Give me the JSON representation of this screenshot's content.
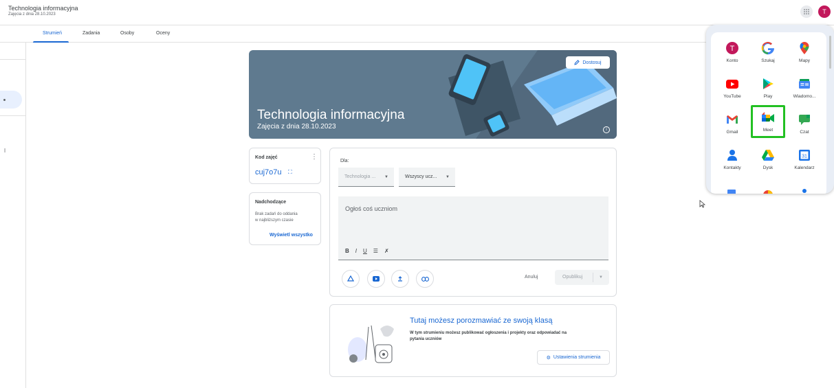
{
  "header": {
    "class_title": "Technologia informacyjna",
    "class_subtitle": "Zajęcia z dnia 28.10.2023",
    "avatar_letter": "T"
  },
  "tabs": [
    {
      "label": "Strumień",
      "active": true
    },
    {
      "label": "Zadania",
      "active": false
    },
    {
      "label": "Osoby",
      "active": false
    },
    {
      "label": "Oceny",
      "active": false
    }
  ],
  "banner": {
    "title": "Technologia informacyjna",
    "subtitle": "Zajęcia z dnia 28.10.2023",
    "customize_label": "Dostosuj"
  },
  "class_code": {
    "label": "Kod zajęć",
    "value": "cuj7o7u"
  },
  "upcoming": {
    "label": "Nadchodzące",
    "empty_line1": "Brak zadań do oddania",
    "empty_line2": "w najbliższym czasie",
    "view_all": "Wyświetl wszystko"
  },
  "composer": {
    "for_label": "Dla:",
    "class_select": "Technologia ...",
    "students_select": "Wszyscy ucz...",
    "placeholder": "Ogłoś coś uczniom",
    "format": {
      "bold": "B",
      "italic": "I",
      "underline": "U"
    },
    "cancel_label": "Anuluj",
    "publish_label": "Opublikuj"
  },
  "stream_empty": {
    "title": "Tutaj możesz porozmawiać ze swoją klasą",
    "desc_line1": "W tym strumieniu możesz publikować ogłoszenia i projekty oraz odpowiadać na",
    "desc_line2": "pytania uczniów",
    "settings_label": "Ustawienia strumienia"
  },
  "apps": [
    {
      "name": "Konto",
      "icon": "account-icon"
    },
    {
      "name": "Szukaj",
      "icon": "google-search-icon"
    },
    {
      "name": "Mapy",
      "icon": "maps-icon"
    },
    {
      "name": "YouTube",
      "icon": "youtube-icon"
    },
    {
      "name": "Play",
      "icon": "play-icon"
    },
    {
      "name": "Wiadomo...",
      "icon": "news-icon"
    },
    {
      "name": "Gmail",
      "icon": "gmail-icon"
    },
    {
      "name": "Meet",
      "icon": "meet-icon",
      "highlighted": true
    },
    {
      "name": "Czat",
      "icon": "chat-icon"
    },
    {
      "name": "Kontakty",
      "icon": "contacts-icon"
    },
    {
      "name": "Dysk",
      "icon": "drive-icon"
    },
    {
      "name": "Kalendarz",
      "icon": "calendar-icon"
    }
  ],
  "colors": {
    "accent": "#1967d2",
    "banner": "#5f7a8f",
    "avatar": "#c2185b",
    "highlight": "#22c022"
  }
}
